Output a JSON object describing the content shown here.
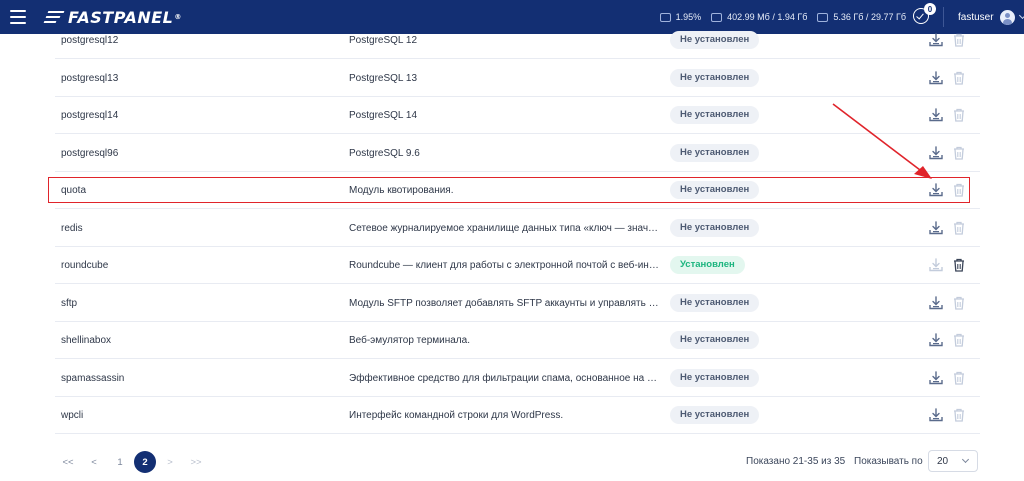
{
  "header": {
    "brand": "FASTPANEL",
    "brand_mark": "®",
    "cpu": "1.95%",
    "memory": "402.99 Мб / 1.94 Гб",
    "disk": "5.36 Гб / 29.77 Гб",
    "notifications_count": "0",
    "username": "fastuser",
    "bg_color": "#132f73"
  },
  "modules": [
    {
      "name": "postgresql12",
      "description": "PostgreSQL 12",
      "status": "Не установлен",
      "installed": false
    },
    {
      "name": "postgresql13",
      "description": "PostgreSQL 13",
      "status": "Не установлен",
      "installed": false
    },
    {
      "name": "postgresql14",
      "description": "PostgreSQL 14",
      "status": "Не установлен",
      "installed": false
    },
    {
      "name": "postgresql96",
      "description": "PostgreSQL 9.6",
      "status": "Не установлен",
      "installed": false
    },
    {
      "name": "quota",
      "description": "Модуль квотирования.",
      "status": "Не установлен",
      "installed": false
    },
    {
      "name": "redis",
      "description": "Сетевое журналируемое хранилище данных типа «ключ — значение»",
      "status": "Не установлен",
      "installed": false
    },
    {
      "name": "roundcube",
      "description": "Roundcube — клиент для работы с электронной почтой с веб-интерфейсом",
      "status": "Установлен",
      "installed": true
    },
    {
      "name": "sftp",
      "description": "Модуль SFTP позволяет добавлять SFTP аккаунты и управлять ими",
      "status": "Не установлен",
      "installed": false
    },
    {
      "name": "shellinabox",
      "description": "Веб-эмулятор терминала.",
      "status": "Не установлен",
      "installed": false
    },
    {
      "name": "spamassassin",
      "description": "Эффективное средство для фильтрации спама, основанное на взаимодействии",
      "status": "Не установлен",
      "installed": false
    },
    {
      "name": "wpcli",
      "description": "Интерфейс командной строки для WordPress.",
      "status": "Не установлен",
      "installed": false
    }
  ],
  "pagination": {
    "first": "<<",
    "prev": "<",
    "pages": [
      "1",
      "2"
    ],
    "current": "2",
    "next": ">",
    "last": ">>",
    "shown": "Показано 21-35 из 35",
    "per_page_label": "Показывать по",
    "per_page_value": "20"
  },
  "icons": {
    "install": "download-icon",
    "delete": "trash-icon"
  },
  "colors": {
    "highlight": "#e0242b",
    "installed_text": "#1cb57f",
    "active_page": "#132f73"
  }
}
